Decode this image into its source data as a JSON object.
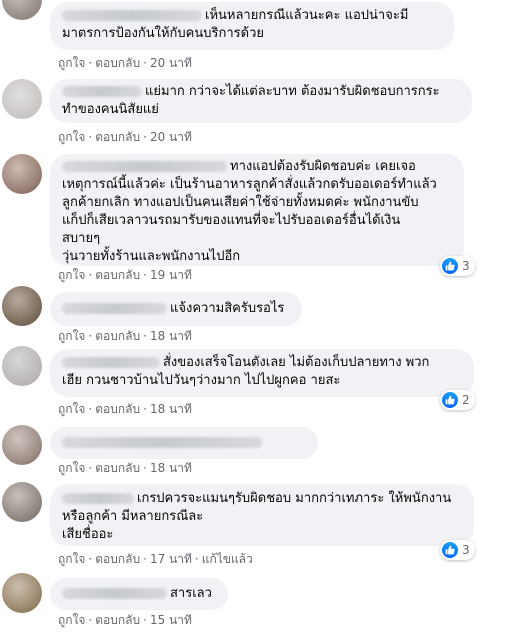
{
  "actions": {
    "like": "ถูกใจ",
    "reply": "ตอบกลับ",
    "edited": "แก้ไขแล้ว"
  },
  "comments": [
    {
      "lines": [
        "เห็นหลายกรณีแล้วนะคะ แอปน่าจะมี",
        "มาตรการป้องกันให้กับคนบริการด้วย"
      ],
      "time": "20 นาที"
    },
    {
      "lines": [
        "แย่มาก กว่าจะได้แต่ละบาท ต้องมารับผิดชอบการกระ",
        "ทำของคนนิสัยแย่"
      ],
      "time": "20 นาที"
    },
    {
      "lines": [
        "ทางแอปต้องรับผิดชอบค่ะ เคยเจอ",
        "เหตุการณ์นี้แล้วค่ะ เป็นร้านอาหารลูกค้าสั่งแล้วกดรับออเดอร์ทำแล้ว",
        "ลูกค้ายกเลิก ทางแอปเป็นคนเสียค่าใช้จ่ายทั้งหมดค่ะ พนักงานขับ",
        "แก็ปก็เสียเวลาวนรถมารับของแทนที่จะไปรับออเดอร์อื่นได้เงิน",
        "สบายๆ",
        "วุ่นวายทั้งร้านและพนักงานไปอีก"
      ],
      "time": "19 นาที",
      "reactions": "3"
    },
    {
      "lines": [
        "แจ้งความสิครับรอไร"
      ],
      "time": "18 นาที"
    },
    {
      "lines": [
        "สั่งของเสร็จโอนตังเลย ไม่ต้องเก็บปลายทาง พวก",
        "เฮีย กวนชาวบ้านไปวันๆว่างมาก ไปไปผูกคอ ายสะ"
      ],
      "time": "18 นาที",
      "reactions": "2"
    },
    {
      "lines": [
        ""
      ],
      "time": "18 นาที"
    },
    {
      "lines": [
        "เกรปควรจะแมนๆรับผิดชอบ มากกว่าเทภาระ ให้พนักงาน",
        "หรือลูกค้า มีหลายกรณีละ",
        "เสียชื่ออะ"
      ],
      "time": "17 นาที",
      "reactions": "3",
      "edited": true
    },
    {
      "lines": [
        "สารเลว"
      ],
      "time": "15 นาที"
    }
  ]
}
